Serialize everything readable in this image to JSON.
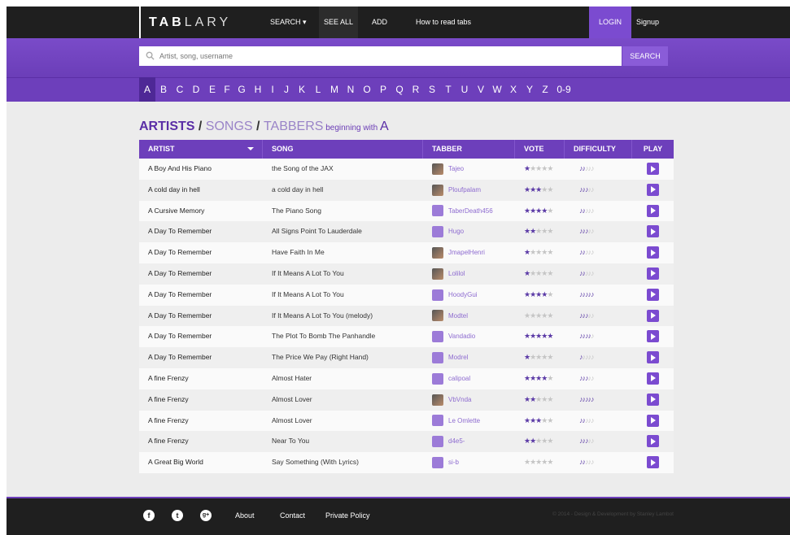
{
  "topnav": {
    "logo_bold": "TAB",
    "logo_light": "LARY",
    "search_label": "SEARCH ▾",
    "see_all_label": "SEE ALL",
    "add_label": "ADD",
    "how_to_label": "How to read tabs",
    "login_label": "LOGIN",
    "signup_label": "Signup"
  },
  "search": {
    "placeholder": "Artist, song, username",
    "button_label": "SEARCH"
  },
  "letters": [
    "A",
    "B",
    "C",
    "D",
    "E",
    "F",
    "G",
    "H",
    "I",
    "J",
    "K",
    "L",
    "M",
    "N",
    "O",
    "P",
    "Q",
    "R",
    "S",
    "T",
    "U",
    "V",
    "W",
    "X",
    "Y",
    "Z",
    "0-9"
  ],
  "active_letter": "A",
  "heading": {
    "artists": "ARTISTS",
    "sep1": " / ",
    "songs": "SONGS",
    "sep2": " / ",
    "tabbers": "TABBERS",
    "suffix": " beginning with ",
    "letter": "A"
  },
  "table": {
    "columns": [
      "ARTIST",
      "SONG",
      "TABBER",
      "VOTE",
      "DIFFICULTY",
      "PLAY"
    ],
    "rows": [
      {
        "artist": "A Boy And His Piano",
        "song": "the Song of the JAX",
        "tabber": "Tajeo",
        "avatar": "photo",
        "vote": 1,
        "difficulty": 2
      },
      {
        "artist": "A cold day in hell",
        "song": "a cold day in hell",
        "tabber": "Ploufpalam",
        "avatar": "photo",
        "vote": 3,
        "difficulty": 3
      },
      {
        "artist": "A Cursive Memory",
        "song": "The Piano Song",
        "tabber": "TaberDeath456",
        "avatar": "default",
        "vote": 4,
        "difficulty": 2
      },
      {
        "artist": "A Day To Remember",
        "song": "All Signs Point To Lauderdale",
        "tabber": "Hugo",
        "avatar": "default",
        "vote": 2,
        "difficulty": 3
      },
      {
        "artist": "A Day To Remember",
        "song": "Have Faith In Me",
        "tabber": "JmapelHenri",
        "avatar": "photo",
        "vote": 1,
        "difficulty": 2
      },
      {
        "artist": "A Day To Remember",
        "song": "If It Means A Lot To You",
        "tabber": "Lolilol",
        "avatar": "photo",
        "vote": 1,
        "difficulty": 2
      },
      {
        "artist": "A Day To Remember",
        "song": "If It Means A Lot To You",
        "tabber": "HoodyGui",
        "avatar": "default",
        "vote": 4,
        "difficulty": 5
      },
      {
        "artist": "A Day To Remember",
        "song": "If It Means A Lot To You (melody)",
        "tabber": "Modtel",
        "avatar": "photo",
        "vote": 0,
        "difficulty": 3
      },
      {
        "artist": "A Day To Remember",
        "song": "The Plot To Bomb The Panhandle",
        "tabber": "Vandadio",
        "avatar": "default",
        "vote": 5,
        "difficulty": 4
      },
      {
        "artist": "A Day To Remember",
        "song": "The Price We Pay (Right Hand)",
        "tabber": "Modrel",
        "avatar": "default",
        "vote": 1,
        "difficulty": 1
      },
      {
        "artist": "A fine Frenzy",
        "song": "Almost Hater",
        "tabber": "calipoal",
        "avatar": "default",
        "vote": 4,
        "difficulty": 3
      },
      {
        "artist": "A fine Frenzy",
        "song": "Almost Lover",
        "tabber": "VbVnda",
        "avatar": "photo",
        "vote": 2,
        "difficulty": 5
      },
      {
        "artist": "A fine Frenzy",
        "song": "Almost Lover",
        "tabber": "Le Omlette",
        "avatar": "default",
        "vote": 3,
        "difficulty": 2
      },
      {
        "artist": "A fine Frenzy",
        "song": "Near To You",
        "tabber": "d4e5-",
        "avatar": "default",
        "vote": 2,
        "difficulty": 3
      },
      {
        "artist": "A Great Big World",
        "song": "Say Something (With Lyrics)",
        "tabber": "si-b",
        "avatar": "default",
        "vote": 0,
        "difficulty": 2
      }
    ]
  },
  "footer": {
    "facebook_icon": "f",
    "twitter_icon": "t",
    "gplus_icon": "g+",
    "about": "About",
    "contact": "Contact",
    "privacy": "Private Policy",
    "copyright": "© 2014 - Design & Development by Stanley Lambot"
  },
  "colors": {
    "brand": "#6d3fbb",
    "dark": "#1f1f1f"
  }
}
